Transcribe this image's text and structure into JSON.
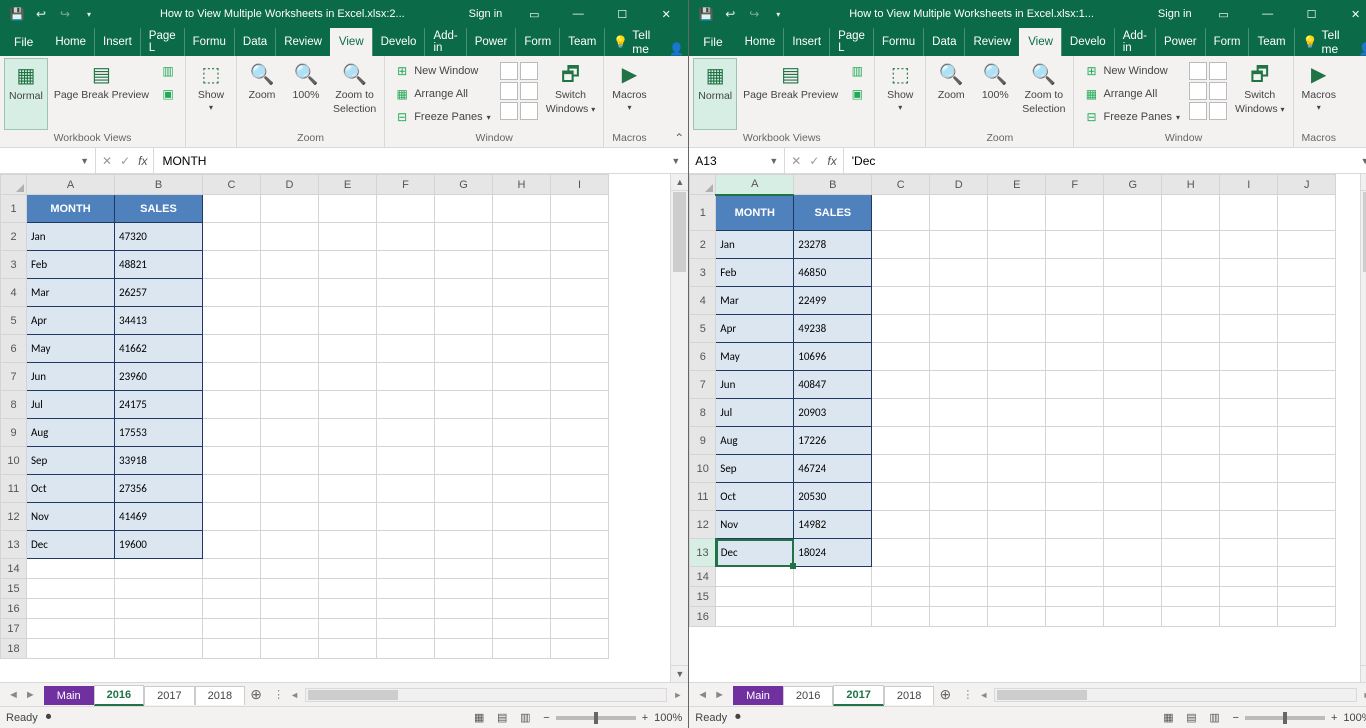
{
  "left": {
    "title": "How to View Multiple Worksheets in Excel.xlsx:2...",
    "signin": "Sign in",
    "file": "File",
    "tabs": [
      "Home",
      "Insert",
      "Page L",
      "Formu",
      "Data",
      "Review",
      "View",
      "Develo",
      "Add-in",
      "Power",
      "Form",
      "Team"
    ],
    "tellme": "Tell me",
    "ribbon": {
      "normal": "Normal",
      "pagebreak": "Page Break Preview",
      "show": "Show",
      "zoom": "Zoom",
      "z100": "100%",
      "ztosel1": "Zoom to",
      "ztosel2": "Selection",
      "newwin": "New Window",
      "arrange": "Arrange All",
      "freeze": "Freeze Panes",
      "switch1": "Switch",
      "switch2": "Windows",
      "macros": "Macros",
      "g_views": "Workbook Views",
      "g_zoom": "Zoom",
      "g_window": "Window",
      "g_macros": "Macros"
    },
    "namebox": "",
    "formula": "MONTH",
    "columns": [
      "A",
      "B",
      "C",
      "D",
      "E",
      "F",
      "G",
      "H",
      "I"
    ],
    "headers": [
      "MONTH",
      "SALES"
    ],
    "data": [
      [
        "Jan",
        "47320"
      ],
      [
        "Feb",
        "48821"
      ],
      [
        "Mar",
        "26257"
      ],
      [
        "Apr",
        "34413"
      ],
      [
        "May",
        "41662"
      ],
      [
        "Jun",
        "23960"
      ],
      [
        "Jul",
        "24175"
      ],
      [
        "Aug",
        "17553"
      ],
      [
        "Sep",
        "33918"
      ],
      [
        "Oct",
        "27356"
      ],
      [
        "Nov",
        "41469"
      ],
      [
        "Dec",
        "19600"
      ]
    ],
    "sheets": [
      "Main",
      "2016",
      "2017",
      "2018"
    ],
    "active_sheet": "2016",
    "hl_sheet": "Main",
    "status": "Ready",
    "zoom": "100%"
  },
  "right": {
    "title": "How to View Multiple Worksheets in Excel.xlsx:1...",
    "signin": "Sign in",
    "file": "File",
    "tabs": [
      "Home",
      "Insert",
      "Page L",
      "Formu",
      "Data",
      "Review",
      "View",
      "Develo",
      "Add-in",
      "Power",
      "Form",
      "Team"
    ],
    "tellme": "Tell me",
    "ribbon": {
      "normal": "Normal",
      "pagebreak": "Page Break Preview",
      "show": "Show",
      "zoom": "Zoom",
      "z100": "100%",
      "ztosel1": "Zoom to",
      "ztosel2": "Selection",
      "newwin": "New Window",
      "arrange": "Arrange All",
      "freeze": "Freeze Panes",
      "switch1": "Switch",
      "switch2": "Windows",
      "macros": "Macros",
      "g_views": "Workbook Views",
      "g_zoom": "Zoom",
      "g_window": "Window",
      "g_macros": "Macros"
    },
    "namebox": "A13",
    "formula": "'Dec",
    "columns": [
      "A",
      "B",
      "C",
      "D",
      "E",
      "F",
      "G",
      "H",
      "I",
      "J"
    ],
    "headers": [
      "MONTH",
      "SALES"
    ],
    "data": [
      [
        "Jan",
        "23278"
      ],
      [
        "Feb",
        "46850"
      ],
      [
        "Mar",
        "22499"
      ],
      [
        "Apr",
        "49238"
      ],
      [
        "May",
        "10696"
      ],
      [
        "Jun",
        "40847"
      ],
      [
        "Jul",
        "20903"
      ],
      [
        "Aug",
        "17226"
      ],
      [
        "Sep",
        "46724"
      ],
      [
        "Oct",
        "20530"
      ],
      [
        "Nov",
        "14982"
      ],
      [
        "Dec",
        "18024"
      ]
    ],
    "sheets": [
      "Main",
      "2016",
      "2017",
      "2018"
    ],
    "active_sheet": "2017",
    "hl_sheet": "Main",
    "status": "Ready",
    "zoom": "100%",
    "sel_row": 13
  }
}
